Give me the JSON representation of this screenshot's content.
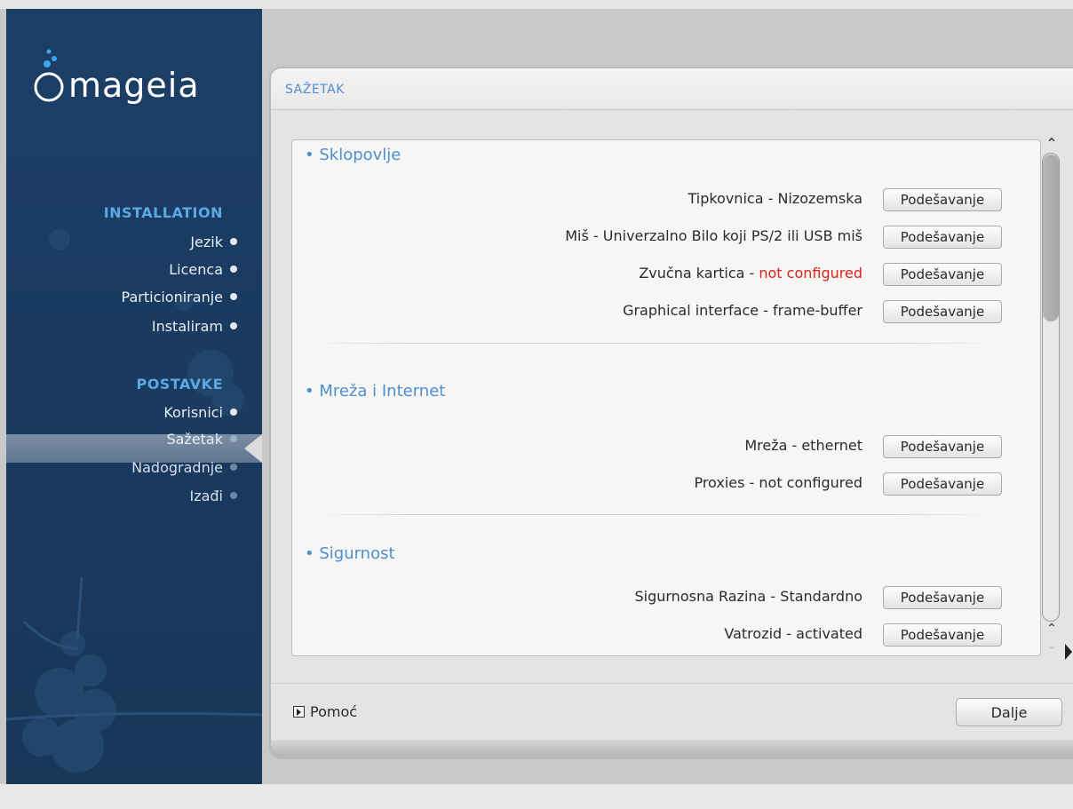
{
  "app": {
    "logo_text": "mageia"
  },
  "sidebar": {
    "sections": [
      {
        "title": "INSTALLATION",
        "steps": [
          {
            "label": "Jezik",
            "state": "done"
          },
          {
            "label": "Licenca",
            "state": "done"
          },
          {
            "label": "Particioniranje",
            "state": "done"
          },
          {
            "label": "Instaliram",
            "state": "done"
          }
        ]
      },
      {
        "title": "POSTAVKE",
        "steps": [
          {
            "label": "Korisnici",
            "state": "done"
          },
          {
            "label": "Sažetak",
            "state": "active"
          },
          {
            "label": "Nadogradnje",
            "state": "pending"
          },
          {
            "label": "Izađi",
            "state": "pending"
          }
        ]
      }
    ]
  },
  "panel": {
    "title": "SAŽETAK"
  },
  "summary": {
    "button_label": "Podešavanje",
    "sections": [
      {
        "title": "• Sklopovlje",
        "rows": [
          {
            "label": "Tipkovnica - Nizozemska",
            "prefix": "",
            "warning": ""
          },
          {
            "label": "Miš - Univerzalno Bilo koji PS/2 ili USB miš",
            "prefix": "",
            "warning": ""
          },
          {
            "label": "",
            "prefix": "Zvučna kartica - ",
            "warning": "not configured"
          },
          {
            "label": "Graphical interface - frame-buffer",
            "prefix": "",
            "warning": ""
          }
        ]
      },
      {
        "title": "• Mreža i Internet",
        "rows": [
          {
            "label": "Mreža - ethernet",
            "prefix": "",
            "warning": ""
          },
          {
            "label": "Proxies - not configured",
            "prefix": "",
            "warning": ""
          }
        ]
      },
      {
        "title": "• Sigurnost",
        "rows": [
          {
            "label": "Sigurnosna Razina - Standardno",
            "prefix": "",
            "warning": ""
          },
          {
            "label": "Vatrozid - activated",
            "prefix": "",
            "warning": ""
          }
        ]
      }
    ]
  },
  "footer": {
    "help_label": "Pomoć",
    "next_label": "Dalje"
  },
  "icons": {
    "help_toggle": "play-triangle-icon",
    "scroll_up": "chevron-up-icon",
    "scroll_down": "chevron-down-icon"
  },
  "colors": {
    "accent": "#4f8fd0",
    "warning": "#e0201a",
    "sidebar": "#1b3b62"
  }
}
